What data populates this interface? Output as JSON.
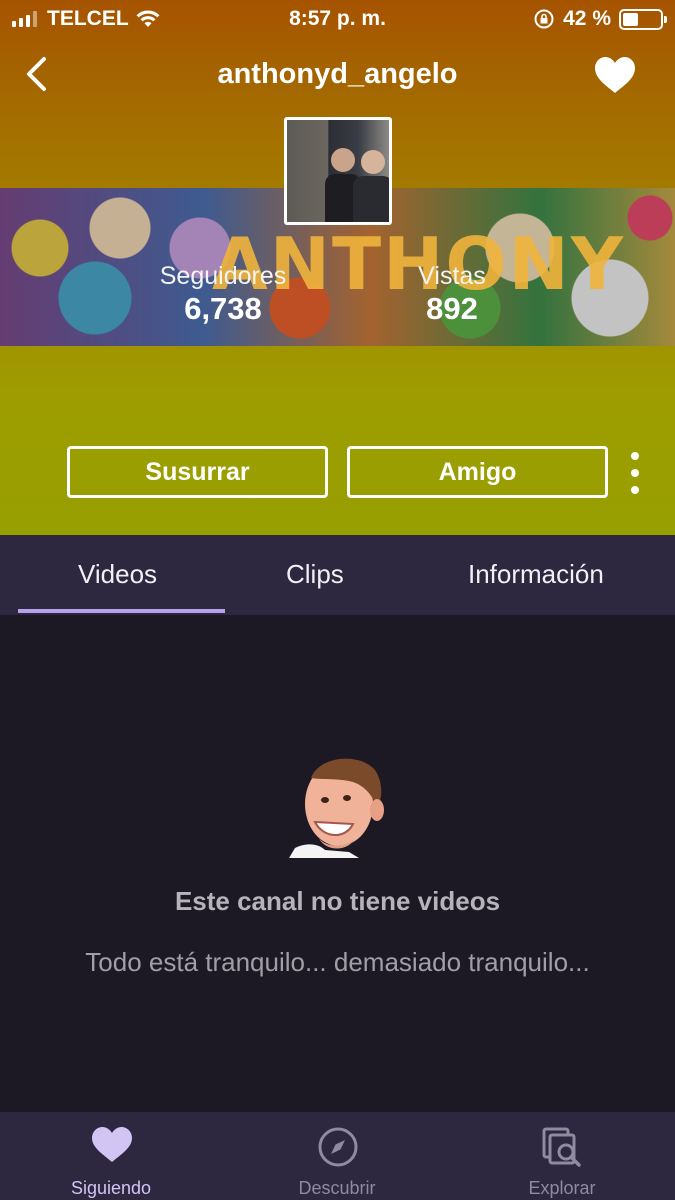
{
  "status_bar": {
    "carrier": "TELCEL",
    "time": "8:57 p. m.",
    "battery": "42 %",
    "battery_level": 0.42
  },
  "header": {
    "username": "anthonyd_angelo"
  },
  "banner": {
    "text": "ANTHONY"
  },
  "stats": {
    "followers_label": "Seguidores",
    "followers_value": "6,738",
    "views_label": "Vistas",
    "views_value": "892"
  },
  "actions": {
    "whisper_label": "Susurrar",
    "friend_label": "Amigo"
  },
  "tabs": [
    {
      "label": "Videos",
      "active": true
    },
    {
      "label": "Clips",
      "active": false
    },
    {
      "label": "Información",
      "active": false
    }
  ],
  "empty_state": {
    "title": "Este canal no tiene videos",
    "subtitle": "Todo está tranquilo... demasiado tranquilo..."
  },
  "bottom_nav": [
    {
      "label": "Siguiendo",
      "icon": "heart-icon",
      "active": true
    },
    {
      "label": "Descubrir",
      "icon": "compass-icon",
      "active": false
    },
    {
      "label": "Explorar",
      "icon": "browse-icon",
      "active": false
    }
  ],
  "colors": {
    "accent": "#b7a1e8",
    "tab_bar": "#2d2740",
    "background": "#1c1824"
  }
}
